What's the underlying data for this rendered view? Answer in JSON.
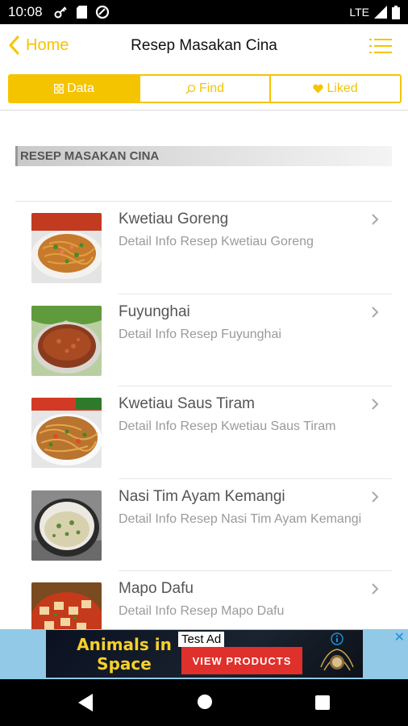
{
  "status_bar": {
    "time": "10:08",
    "network": "LTE"
  },
  "nav": {
    "back_label": "Home",
    "title": "Resep Masakan Cina"
  },
  "tabs": [
    {
      "label": "Data",
      "icon": "grid-icon",
      "active": true
    },
    {
      "label": "Find",
      "icon": "search-icon",
      "active": false
    },
    {
      "label": "Liked",
      "icon": "heart-icon",
      "active": false
    }
  ],
  "section": {
    "header": "RESEP MASAKAN CINA"
  },
  "recipes": [
    {
      "title": "Kwetiau Goreng",
      "description": "Detail Info Resep Kwetiau Goreng"
    },
    {
      "title": "Fuyunghai",
      "description": "Detail Info Resep Fuyunghai"
    },
    {
      "title": "Kwetiau Saus Tiram",
      "description": "Detail Info Resep Kwetiau Saus Tiram"
    },
    {
      "title": "Nasi Tim Ayam Kemangi",
      "description": "Detail Info Resep Nasi Tim Ayam Kemangi"
    },
    {
      "title": "Mapo Dafu",
      "description": "Detail Info Resep Mapo Dafu"
    }
  ],
  "ad": {
    "headline": "Animals in Space",
    "tag": "Test Ad",
    "cta": "VIEW PRODUCTS"
  },
  "colors": {
    "accent": "#f5c400",
    "ad_background": "#91c9e6",
    "ad_cta": "#e0302b"
  }
}
